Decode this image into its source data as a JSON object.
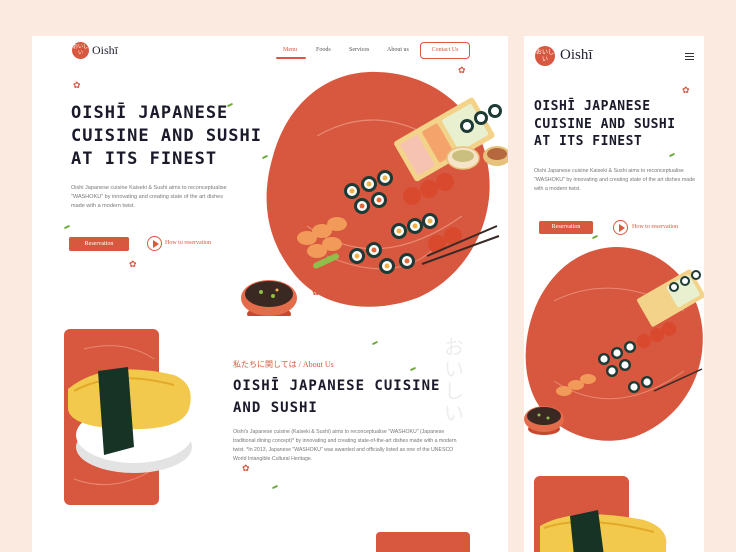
{
  "desktop": {
    "logo_badge": "おいしい",
    "logo_text": "Oishī",
    "nav": [
      "Menu",
      "Foods",
      "Services",
      "About us"
    ],
    "contact_label": "Contact Us",
    "hero_title": "OISHĪ JAPANESE CUISINE AND SUSHI AT ITS FINEST",
    "hero_desc": "Oishi Japanese cuisine Kaiseki & Sushi aims to reconceptualise \"WASHOKU\" by innovating and creating state of the art dishes made with a modern twist.",
    "reservation_label": "Reservation",
    "how_to_label": "How to reservation",
    "about_kicker": "私たちに関しては / About Us",
    "about_title": "OISHĪ JAPANESE CUISINE AND SUSHI",
    "about_desc": "Oishi's Japanese cuisine (Kaiseki & Sushi) aims to reconceptualise \"WASHOKU\" (Japanese traditional dining concept)* by innovating and creating state-of-the-art dishes made with a modern twist. *In 2013, Japanese \"WASHOKU\" was awarded and officially listed as one of the UNESCO World Intangible Cultural Heritage.",
    "vertical_jp": "おいしい"
  },
  "mobile": {
    "logo_badge": "おいしい",
    "logo_text": "Oishī",
    "hero_title": "OISHĪ JAPANESE CUISINE AND SUSHI AT ITS FINEST",
    "hero_desc": "Oishi Japanese cuisine Kaiseki & Sushi aims to reconceptualise \"WASHOKU\" by innovating and creating state of the art dishes made with a modern twist.",
    "reservation_label": "Reservation",
    "how_to_label": "How to reservation"
  },
  "colors": {
    "accent": "#d8573f",
    "ink": "#1a1a2b",
    "background": "#fbeadf"
  },
  "icons": [
    "menu-icon",
    "play-icon",
    "sakura-icon",
    "leaf-icon"
  ]
}
